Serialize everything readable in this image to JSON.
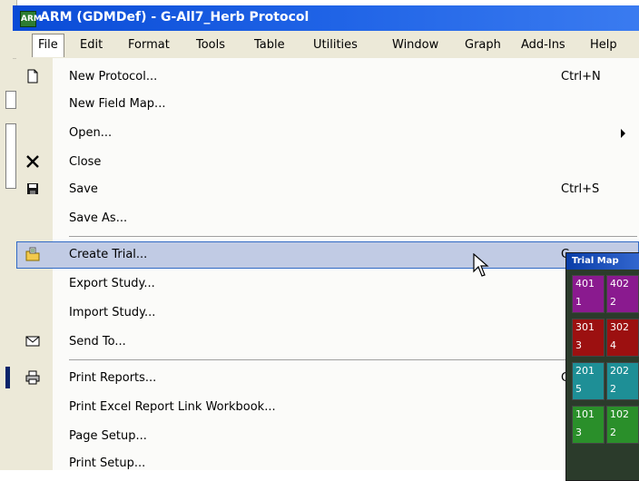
{
  "window": {
    "title": "ARM (GDMDef) - G-All7_Herb Protocol"
  },
  "menubar": [
    "File",
    "Edit",
    "Format",
    "Tools",
    "Table",
    "Utilities",
    "Window",
    "Graph",
    "Add-Ins",
    "Help"
  ],
  "file_menu": {
    "items": [
      {
        "label": "New Protocol...",
        "shortcut": "Ctrl+N",
        "icon": "new-document-icon"
      },
      {
        "label": "New Field Map..."
      },
      {
        "label": "Open...",
        "submenu": true
      },
      {
        "label": "Close",
        "icon": "close-icon"
      },
      {
        "label": "Save",
        "shortcut": "Ctrl+S",
        "icon": "floppy-disk-icon"
      },
      {
        "label": "Save As..."
      },
      {
        "label": "Create Trial...",
        "shortcut": "C",
        "icon": "create-trial-icon",
        "highlighted": true
      },
      {
        "label": "Export Study..."
      },
      {
        "label": "Import Study..."
      },
      {
        "label": "Send To...",
        "icon": "envelope-icon"
      },
      {
        "label": "Print Reports...",
        "shortcut": "C",
        "icon": "printer-icon"
      },
      {
        "label": "Print Excel Report Link Workbook..."
      },
      {
        "label": "Page Setup..."
      },
      {
        "label": "Print Setup..."
      }
    ]
  },
  "trial_map": {
    "title": "Trial Map",
    "plots": [
      {
        "top": "401",
        "bottom": "1",
        "color": "#8a1a8f"
      },
      {
        "top": "402",
        "bottom": "2",
        "color": "#8a1a8f"
      },
      {
        "top": "301",
        "bottom": "3",
        "color": "#9c1010"
      },
      {
        "top": "302",
        "bottom": "4",
        "color": "#9c1010"
      },
      {
        "top": "201",
        "bottom": "5",
        "color": "#1e8f96"
      },
      {
        "top": "202",
        "bottom": "2",
        "color": "#1e8f96"
      },
      {
        "top": "101",
        "bottom": "3",
        "color": "#2a8f2a"
      },
      {
        "top": "102",
        "bottom": "2",
        "color": "#2a8f2a"
      }
    ]
  },
  "colors": {
    "title_bar": "#0a4bd6",
    "highlight": "#c1cbe4",
    "highlight_border": "#316ac5"
  }
}
